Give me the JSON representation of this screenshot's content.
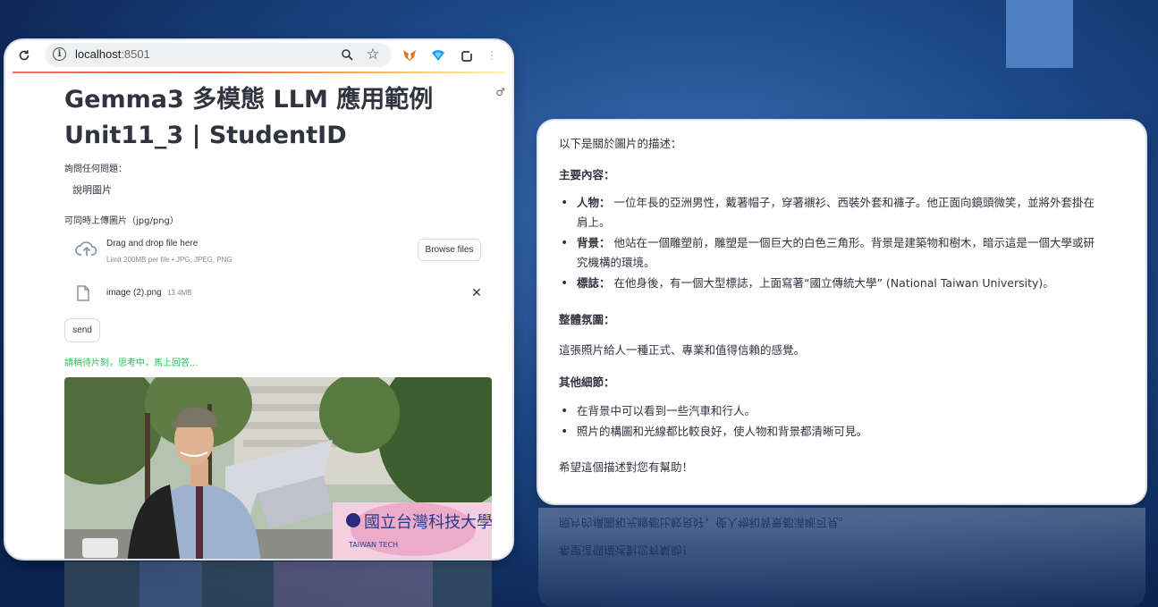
{
  "browser": {
    "url_host": "localhost",
    "url_port": ":8501"
  },
  "app": {
    "title_line1": "Gemma3 多模態 LLM 應用範例",
    "title_line2": "Unit11_3 | StudentID",
    "question_label": "詢問任何問題：",
    "question_value": "說明圖片",
    "upload_label": "可同時上傳圖片（jpg/png）",
    "dropzone_title": "Drag and drop file here",
    "dropzone_limit": "Limit 200MB per file • JPG, JPEG, PNG",
    "browse_button": "Browse files",
    "file_name": "image (2).png",
    "file_size": "13.4MB",
    "send_button": "send",
    "status_text": "請稍待片刻，思考中，馬上回答...",
    "photo_sign": "國立台灣科技大學",
    "photo_sign_en": "TAIWAN TECH"
  },
  "description": {
    "intro": "以下是關於圖片的描述：",
    "main_heading": "主要內容：",
    "main_items": [
      {
        "label": "人物：",
        "text": "一位年長的亞洲男性，戴著帽子，穿著襯衫、西裝外套和褲子。他正面向鏡頭微笑，並將外套掛在肩上。"
      },
      {
        "label": "背景：",
        "text": "他站在一個雕塑前，雕塑是一個巨大的白色三角形。背景是建築物和樹木，暗示這是一個大學或研究機構的環境。"
      },
      {
        "label": "標誌：",
        "text": "在他身後，有一個大型標誌，上面寫著“國立傳統大學” (National Taiwan University)。"
      }
    ],
    "atmosphere_heading": "整體氛圍：",
    "atmosphere_text": "這張照片給人一種正式、專業和值得信賴的感覺。",
    "other_heading": "其他細節：",
    "other_items": [
      "在背景中可以看到一些汽車和行人。",
      "照片的構圖和光線都比較良好，使人物和背景都清晰可見。"
    ],
    "closing": "希望這個描述對您有幫助！"
  }
}
